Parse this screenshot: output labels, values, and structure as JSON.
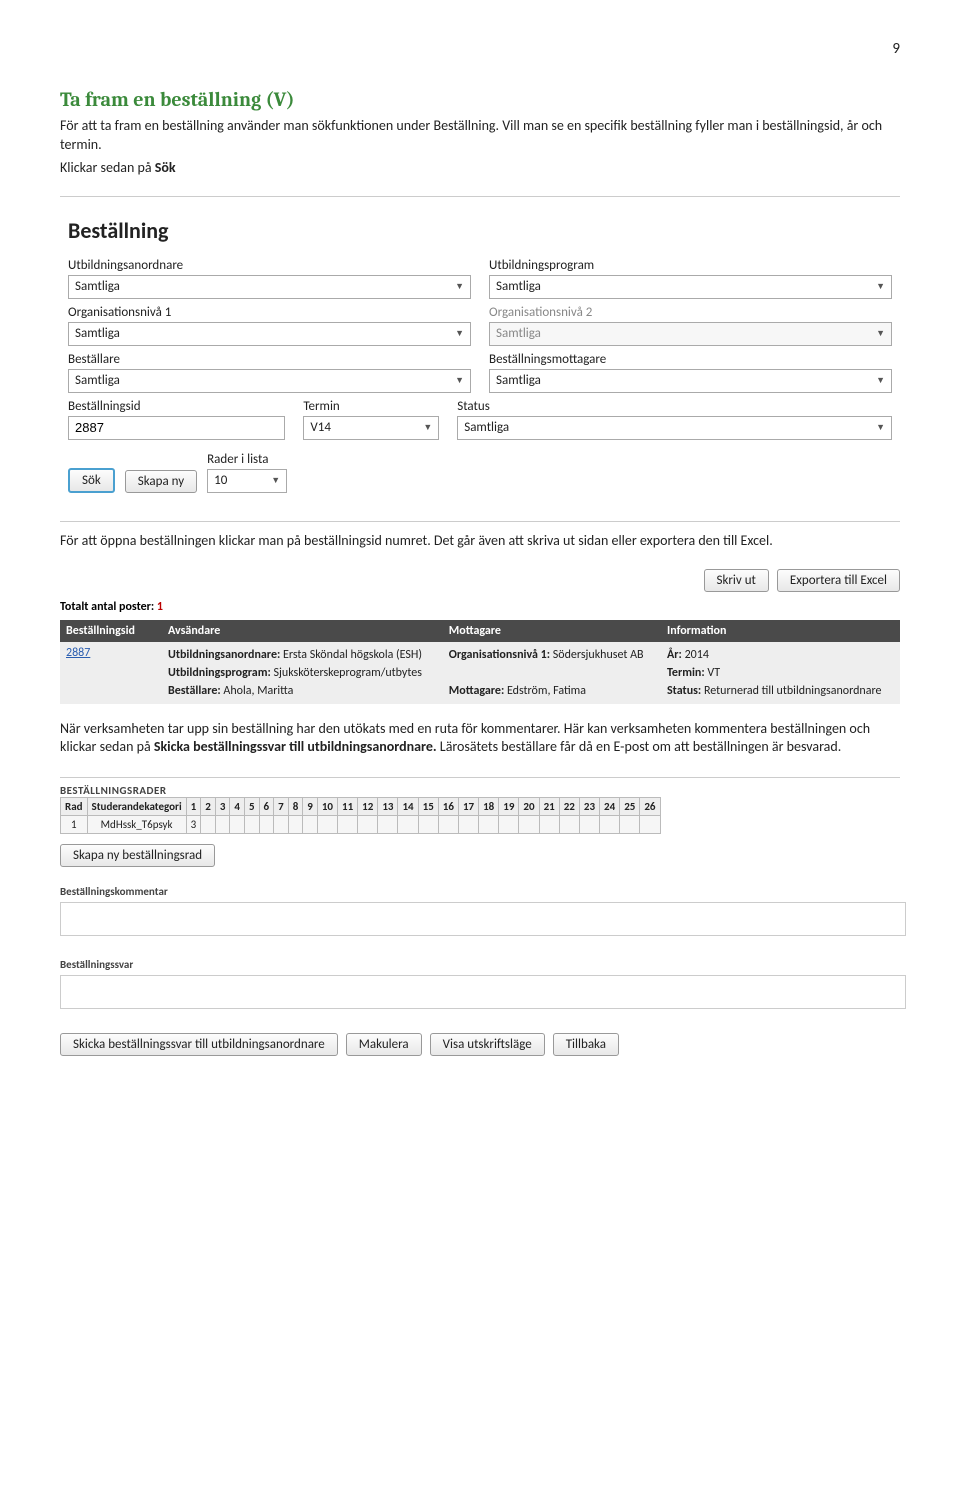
{
  "page_number": "9",
  "heading": "Ta fram en beställning (V)",
  "para1_a": "För att ta fram en beställning använder man sökfunktionen under Beställning. Vill man se en specifik beställning fyller man i beställningsid, år och termin.",
  "para1_b": "Klickar sedan på ",
  "para1_b_strong": "Sök",
  "form": {
    "title": "Beställning",
    "utbildningsanordnare": {
      "label": "Utbildningsanordnare",
      "value": "Samtliga"
    },
    "utbildningsprogram": {
      "label": "Utbildningsprogram",
      "value": "Samtliga"
    },
    "orgnivel1": {
      "label": "Organisationsnivå 1",
      "value": "Samtliga"
    },
    "orgnivel2": {
      "label": "Organisationsnivå 2",
      "value": "Samtliga"
    },
    "bestallare": {
      "label": "Beställare",
      "value": "Samtliga"
    },
    "mottagare": {
      "label": "Beställningsmottagare",
      "value": "Samtliga"
    },
    "bestallningsid": {
      "label": "Beställningsid",
      "value": "2887"
    },
    "termin": {
      "label": "Termin",
      "value": "V14"
    },
    "status": {
      "label": "Status",
      "value": "Samtliga"
    },
    "rader": {
      "label": "Rader i lista",
      "value": "10"
    },
    "btn_sok": "Sök",
    "btn_skapany": "Skapa ny"
  },
  "para2": "För att öppna beställningen klickar man på beställningsid numret. Det går även att skriva ut sidan eller exportera den till Excel.",
  "results": {
    "btn_skrivut": "Skriv ut",
    "btn_export": "Exportera till Excel",
    "totalt_label": "Totalt antal poster:",
    "totalt_count": "1",
    "headers": [
      "Beställningsid",
      "Avsändare",
      "Mottagare",
      "Information"
    ],
    "row": {
      "id": "2887",
      "avsandare": {
        "l1": "Utbildningsanordnare:",
        "v1": "Ersta Sköndal högskola (ESH)",
        "l2": "Utbildningsprogram:",
        "v2": "Sjuksköterskeprogram/utbytes",
        "l3": "Beställare:",
        "v3": "Ahola, Maritta"
      },
      "mottagare": {
        "l1": "Organisationsnivå 1:",
        "v1": "Södersjukhuset AB",
        "l2": "Mottagare:",
        "v2": "Edström, Fatima"
      },
      "info": {
        "l1": "År:",
        "v1": "2014",
        "l2": "Termin:",
        "v2": "VT",
        "l3": "Status:",
        "v3": "Returnerad till utbildningsanordnare"
      }
    }
  },
  "para3_a": "När verksamheten tar upp sin beställning har den utökats med en ruta för kommentarer. Här kan verksamheten kommentera beställningen och klickar sedan på ",
  "para3_strong": "Skicka beställningssvar till utbildningsanordnare.",
  "para3_b": " Lärosätets beställare får då en E-post om att beställningen är besvarad.",
  "rows_section": {
    "title": "BESTÄLLNINGSRADER",
    "head": [
      "Rad",
      "Studerandekategori",
      "1",
      "2",
      "3",
      "4",
      "5",
      "6",
      "7",
      "8",
      "9",
      "10",
      "11",
      "12",
      "13",
      "14",
      "15",
      "16",
      "17",
      "18",
      "19",
      "20",
      "21",
      "22",
      "23",
      "24",
      "25",
      "26"
    ],
    "row": [
      "1",
      "MdHssk_T6psyk",
      "3",
      "",
      "",
      "",
      "",
      "",
      "",
      "",
      "",
      "",
      "",
      "",
      "",
      "",
      "",
      "",
      "",
      "",
      "",
      "",
      "",
      "",
      "",
      "",
      "",
      ""
    ],
    "btn_newrow": "Skapa ny beställningsrad"
  },
  "comment1_label": "Beställningskommentar",
  "comment2_label": "Beställningssvar",
  "bottom_buttons": {
    "b1": "Skicka beställningssvar till utbildningsanordnare",
    "b2": "Makulera",
    "b3": "Visa utskriftsläge",
    "b4": "Tillbaka"
  }
}
